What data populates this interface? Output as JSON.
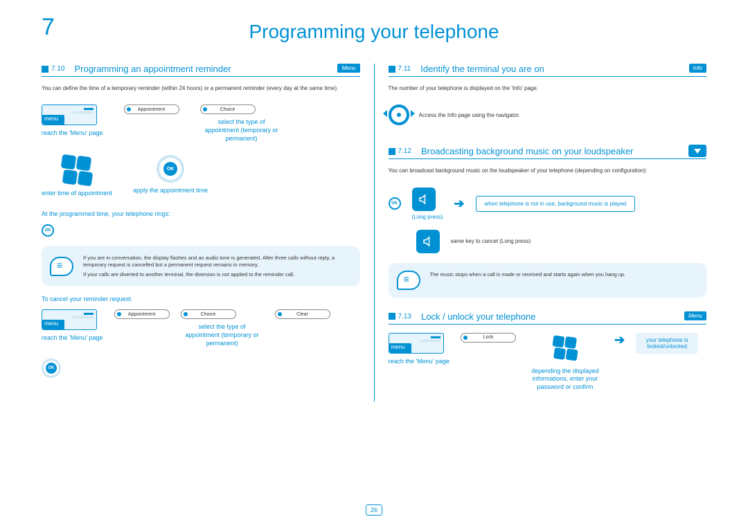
{
  "chapter_number": "7",
  "doc_title": "Programming your telephone",
  "page_number": "26",
  "left": {
    "s710": {
      "num": "7.10",
      "title": "Programming an appointment reminder",
      "badge": "Menu",
      "intro": "You can define the time of a temporary reminder (within 24 hours) or a permanent reminder (every day at the same time).",
      "menu_label": "menu",
      "reach_menu": "reach the 'Menu' page",
      "sk_appt": "Appointment",
      "sk_choice": "Choice",
      "select_type": "select the type of appointment (temporary or permanent)",
      "enter_time": "enter time of appointment",
      "apply_time": "apply the appointment time",
      "ring_note": "At the programmed time, your telephone rings:",
      "callout1a": "If you are in conversation, the display flashes and an audio tone is generated. After three calls without reply, a temporary request is cancelled but a permanent request remains in memory.",
      "callout1b": "If your calls are diverted to another terminal, the diversion is not applied to the reminder call.",
      "cancel_note": "To cancel your reminder request:",
      "sk_clear": "Clear",
      "select_type2": "select the type of appointment (temporary or permanent)"
    }
  },
  "right": {
    "s711": {
      "num": "7.11",
      "title": "Identify the terminal you are on",
      "badge": "Info",
      "intro": "The number of your telephone is displayed on the 'Info' page.",
      "nav_label": "Access the Info page using the navigator."
    },
    "s712": {
      "num": "7.12",
      "title": "Broadcasting background music on your loudspeaker",
      "intro": "You can broadcast background music on the loudspeaker of your telephone (depending on configuration):",
      "long_press": "(Long press)",
      "box1": "when telephone is not in use, background music is played",
      "cancel_label": "same key to cancel (Long press)",
      "callout": "The music stops when a call is made or received and starts again when you hang up."
    },
    "s713": {
      "num": "7.13",
      "title": "Lock / unlock your telephone",
      "badge": "Menu",
      "menu_label": "menu",
      "reach_menu": "reach the 'Menu' page",
      "sk_lock": "Lock",
      "depending": "depending the displayed informations, enter your password or confirm",
      "result": "your telephone is locked/unlocked"
    }
  }
}
